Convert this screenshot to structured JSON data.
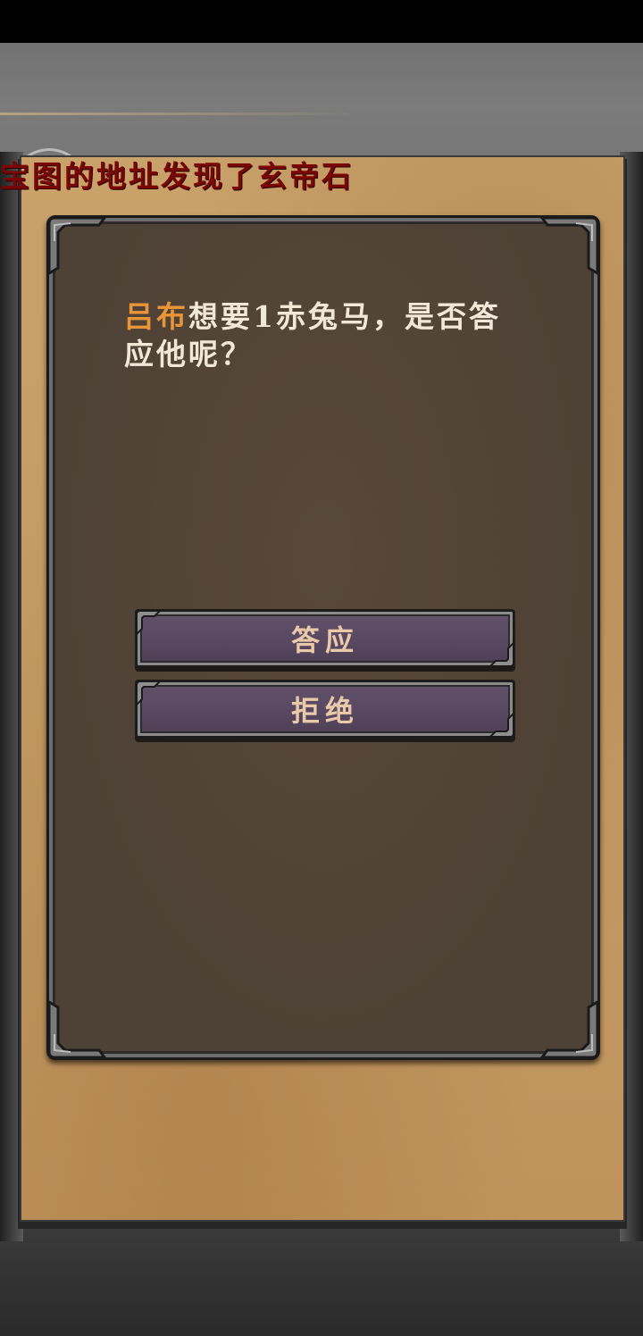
{
  "banner": {
    "text": "宝图的地址发现了玄帝石"
  },
  "dialog": {
    "speaker": "吕布",
    "message": "想要1赤兔马，是否答应他呢？"
  },
  "buttons": {
    "accept_label": "答应",
    "reject_label": "拒绝"
  },
  "colors": {
    "speaker": "#e89538",
    "message": "#f1e8d8",
    "banner": "#7a0606",
    "button_label": "#e9c9a7",
    "button_fill": "#574760",
    "dialog_fill": "#4e4135",
    "parchment": "#c49a63"
  }
}
